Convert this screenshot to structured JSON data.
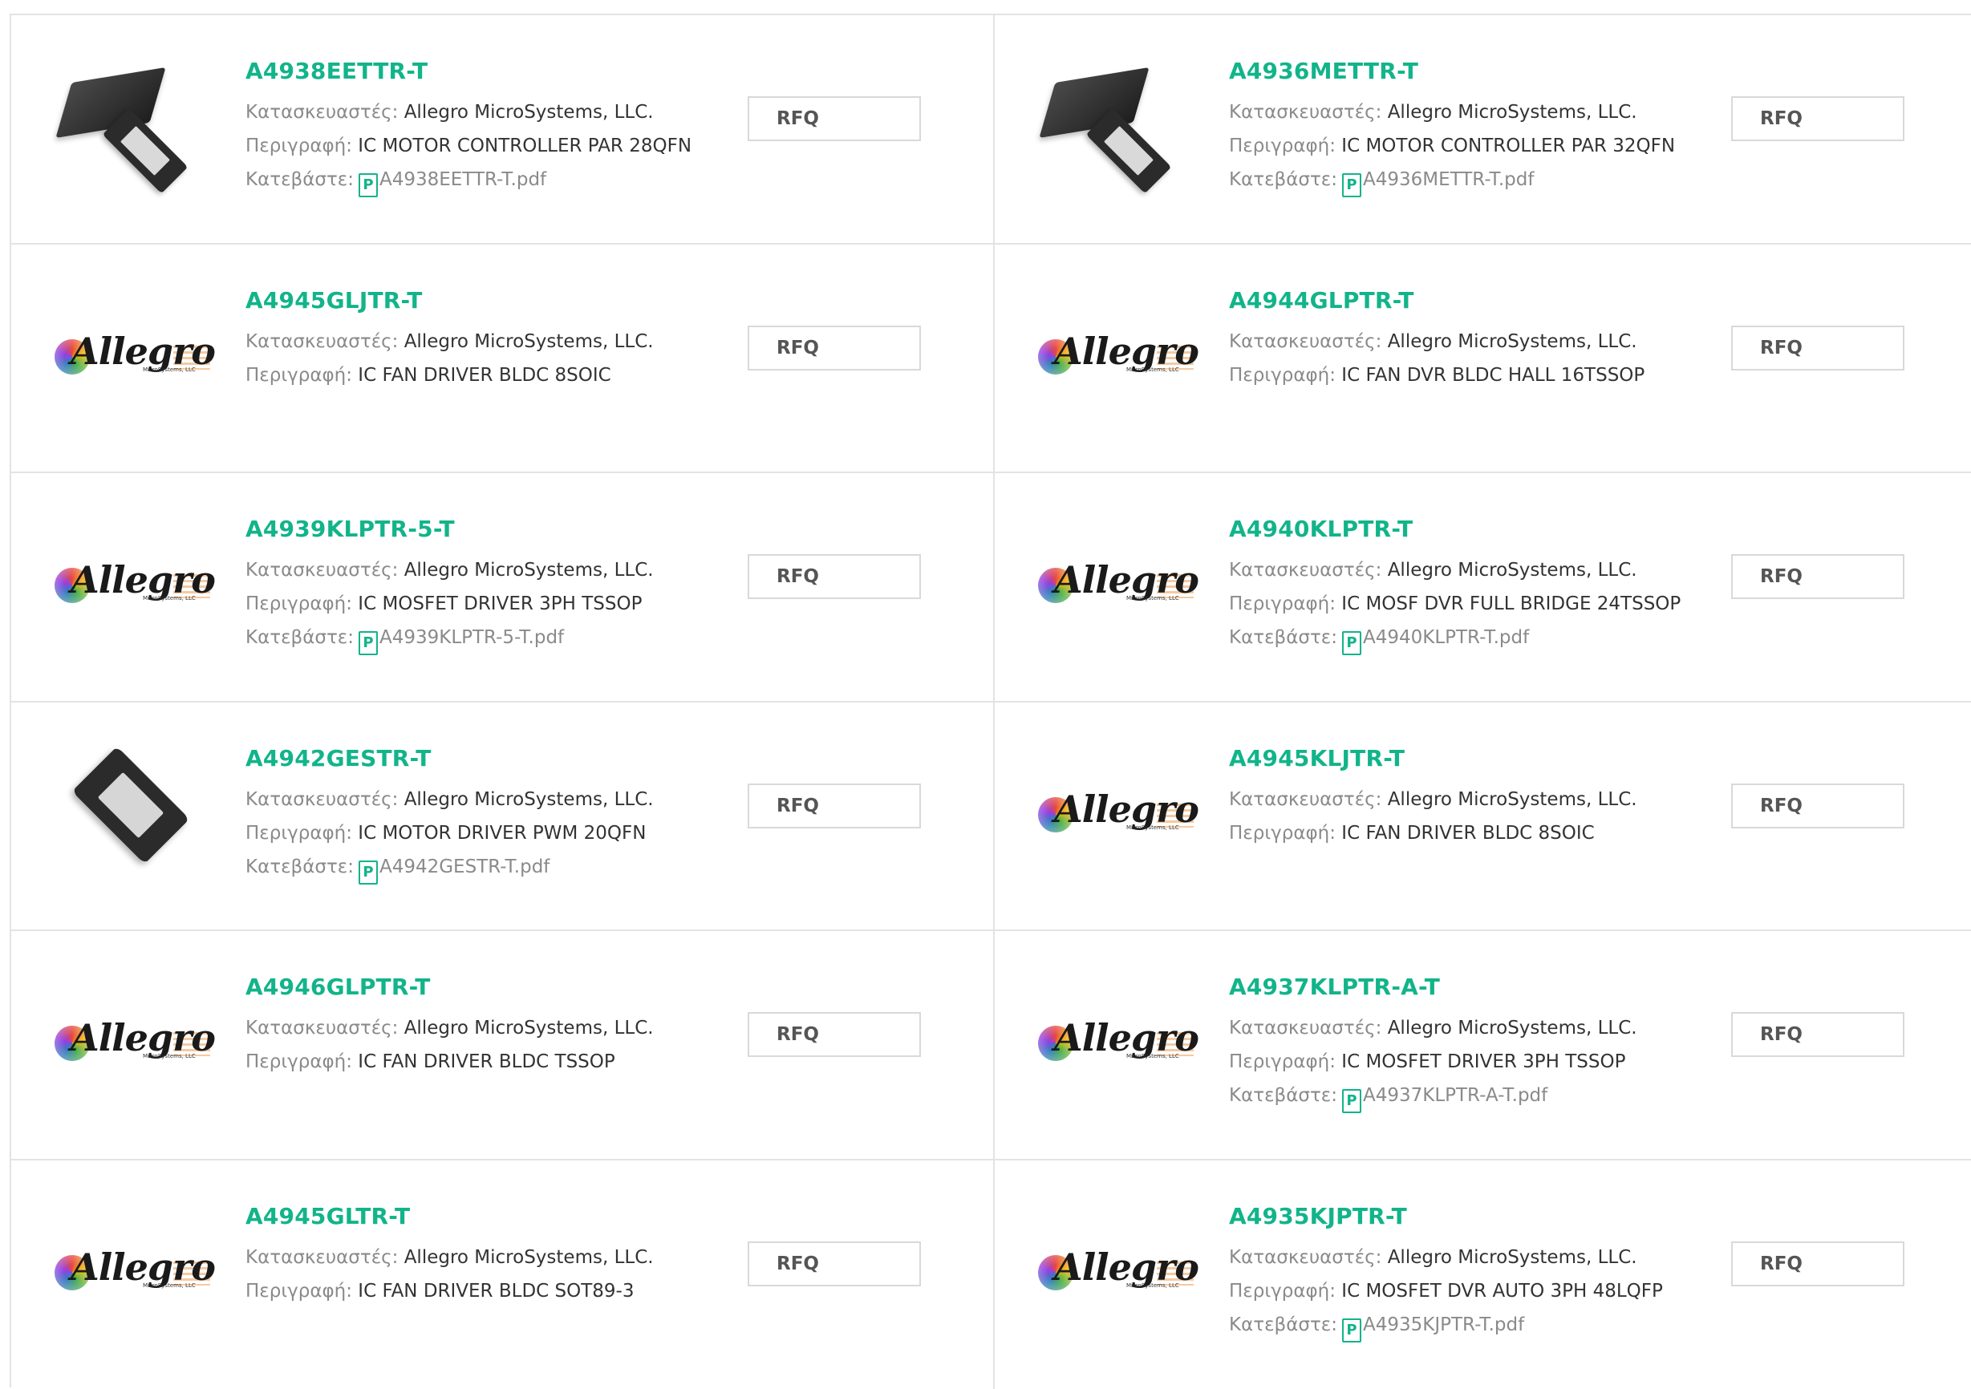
{
  "labels": {
    "manufacturer": "Κατασκευαστές:",
    "description": "Περιγραφή:",
    "download": "Κατεβάστε:",
    "rfq": "RFQ",
    "pdf_icon_glyph": "P"
  },
  "logo": {
    "word": "Allegro",
    "sub": "MicroSystems, LLC"
  },
  "colors": {
    "part_number": "#12b48a",
    "border": "#e3e3e3"
  },
  "products": [
    {
      "part": "A4938EETTR-T",
      "manufacturer": "Allegro MicroSystems, LLC.",
      "description": "IC MOTOR CONTROLLER PAR 28QFN",
      "pdf": "A4938EETTR-T.pdf",
      "image": "chip-pair"
    },
    {
      "part": "A4936METTR-T",
      "manufacturer": "Allegro MicroSystems, LLC.",
      "description": "IC MOTOR CONTROLLER PAR 32QFN",
      "pdf": "A4936METTR-T.pdf",
      "image": "chip-pair"
    },
    {
      "part": "A4945GLJTR-T",
      "manufacturer": "Allegro MicroSystems, LLC.",
      "description": "IC FAN DRIVER BLDC 8SOIC",
      "pdf": "",
      "image": "allegro-logo"
    },
    {
      "part": "A4944GLPTR-T",
      "manufacturer": "Allegro MicroSystems, LLC.",
      "description": "IC FAN DVR BLDC HALL 16TSSOP",
      "pdf": "",
      "image": "allegro-logo"
    },
    {
      "part": "A4939KLPTR-5-T",
      "manufacturer": "Allegro MicroSystems, LLC.",
      "description": "IC MOSFET DRIVER 3PH TSSOP",
      "pdf": "A4939KLPTR-5-T.pdf",
      "image": "allegro-logo"
    },
    {
      "part": "A4940KLPTR-T",
      "manufacturer": "Allegro MicroSystems, LLC.",
      "description": "IC MOSF DVR FULL BRIDGE 24TSSOP",
      "pdf": "A4940KLPTR-T.pdf",
      "image": "allegro-logo"
    },
    {
      "part": "A4942GESTR-T",
      "manufacturer": "Allegro MicroSystems, LLC.",
      "description": "IC MOTOR DRIVER PWM 20QFN",
      "pdf": "A4942GESTR-T.pdf",
      "image": "chip-single"
    },
    {
      "part": "A4945KLJTR-T",
      "manufacturer": "Allegro MicroSystems, LLC.",
      "description": "IC FAN DRIVER BLDC 8SOIC",
      "pdf": "",
      "image": "allegro-logo"
    },
    {
      "part": "A4946GLPTR-T",
      "manufacturer": "Allegro MicroSystems, LLC.",
      "description": "IC FAN DRIVER BLDC TSSOP",
      "pdf": "",
      "image": "allegro-logo"
    },
    {
      "part": "A4937KLPTR-A-T",
      "manufacturer": "Allegro MicroSystems, LLC.",
      "description": "IC MOSFET DRIVER 3PH TSSOP",
      "pdf": "A4937KLPTR-A-T.pdf",
      "image": "allegro-logo"
    },
    {
      "part": "A4945GLTR-T",
      "manufacturer": "Allegro MicroSystems, LLC.",
      "description": "IC FAN DRIVER BLDC SOT89-3",
      "pdf": "",
      "image": "allegro-logo"
    },
    {
      "part": "A4935KJPTR-T",
      "manufacturer": "Allegro MicroSystems, LLC.",
      "description": "IC MOSFET DVR AUTO 3PH 48LQFP",
      "pdf": "A4935KJPTR-T.pdf",
      "image": "allegro-logo"
    }
  ]
}
